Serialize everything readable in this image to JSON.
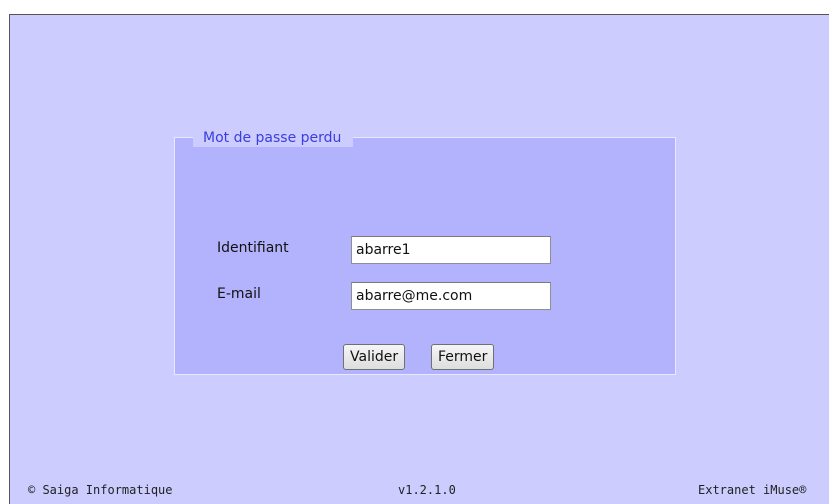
{
  "form": {
    "legend": "Mot de passe perdu",
    "identifiant_label": "Identifiant",
    "identifiant_value": "abarre1",
    "email_label": "E-mail",
    "email_value": "abarre@me.com",
    "valider_label": "Valider",
    "fermer_label": "Fermer"
  },
  "footer": {
    "copyright": "© Saiga Informatique",
    "version": "v1.2.1.0",
    "product": "Extranet iMuse®"
  },
  "colors": {
    "page_background": "#ccccff",
    "form_background": "#b3b3fd",
    "legend_text": "#3a3ee0"
  }
}
